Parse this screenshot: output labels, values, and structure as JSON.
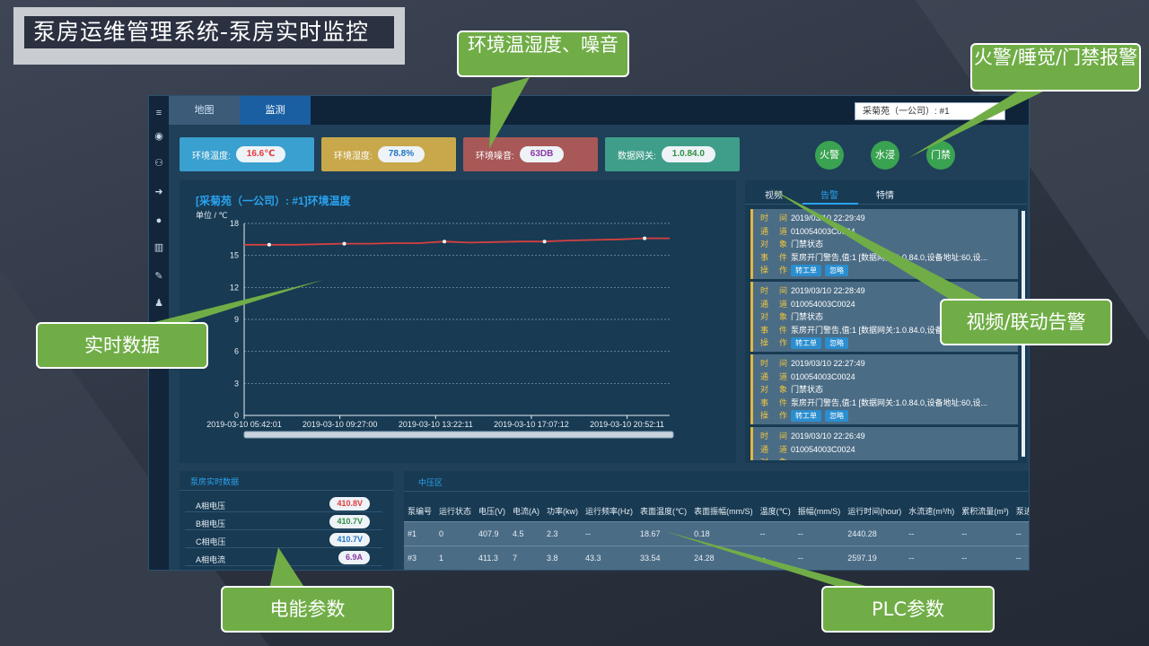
{
  "slide_title": "泵房运维管理系统-泵房实时监控",
  "app": {
    "tabs": [
      {
        "label": "地图"
      },
      {
        "label": "监测"
      }
    ],
    "site_select": "采菊苑（一公司）: #1",
    "env_cards": [
      {
        "label": "环境温度:",
        "value": "16.6℃",
        "color": "#e23b3b"
      },
      {
        "label": "环境湿度:",
        "value": "78.8%",
        "color": "#1f74c2"
      },
      {
        "label": "环境噪音:",
        "value": "63DB",
        "color": "#8b3aa3"
      },
      {
        "label": "数据网关:",
        "value": "1.0.84.0",
        "color": "#2f8e43"
      }
    ],
    "alarm_buttons": [
      {
        "label": "火警"
      },
      {
        "label": "水浸"
      },
      {
        "label": "门禁"
      }
    ],
    "chart_panel": {
      "title": "[采菊苑（一公司）: #1]环境温度",
      "unit": "单位 / ℃"
    },
    "alarm_tabs": [
      {
        "label": "视频"
      },
      {
        "label": "告警"
      },
      {
        "label": "特情"
      }
    ],
    "alarm_keys": {
      "time": "时间",
      "channel": "通道",
      "object": "对象",
      "event": "事件",
      "action": "操作"
    },
    "alarm_buttons_labels": {
      "ticket": "转工单",
      "ignore": "忽略"
    },
    "alarms": [
      {
        "time": "2019/03/10 22:29:49",
        "channel": "010054003C0024",
        "object": "门禁状态",
        "event": "泵房开门警告,值:1 [数据网关:1.0.84.0,设备地址:60,设..."
      },
      {
        "time": "2019/03/10 22:28:49",
        "channel": "010054003C0024",
        "object": "门禁状态",
        "event": "泵房开门警告,值:1 [数据网关:1.0.84.0,设备地址:60,设..."
      },
      {
        "time": "2019/03/10 22:27:49",
        "channel": "010054003C0024",
        "object": "门禁状态",
        "event": "泵房开门警告,值:1 [数据网关:1.0.84.0,设备地址:60,设..."
      },
      {
        "time": "2019/03/10 22:26:49",
        "channel": "010054003C0024",
        "object": "",
        "event": ""
      }
    ],
    "elec_panel": {
      "title": "泵房实时数据",
      "rows": [
        {
          "name": "A相电压",
          "value": "410.8V",
          "color": "#e23b3b"
        },
        {
          "name": "B相电压",
          "value": "410.7V",
          "color": "#2f8e43"
        },
        {
          "name": "C相电压",
          "value": "410.7V",
          "color": "#1f74c2"
        },
        {
          "name": "A相电流",
          "value": "6.9A",
          "color": "#8b3aa3"
        }
      ]
    },
    "plc_panel": {
      "tab": "中压区",
      "headers": [
        "泵编号",
        "运行状态",
        "电压(V)",
        "电流(A)",
        "功率(kw)",
        "运行频率(Hz)",
        "表面温度(℃)",
        "表面振幅(mm/S)",
        "温度(℃)",
        "振幅(mm/S)",
        "运行时间(hour)",
        "水流速(m³/h)",
        "累积流量(m³)",
        "泵进"
      ],
      "rows": [
        [
          "#1",
          "0",
          "407.9",
          "4.5",
          "2.3",
          "--",
          "18.67",
          "0.18",
          "--",
          "--",
          "2440.28",
          "--",
          "--",
          "--"
        ],
        [
          "#3",
          "1",
          "411.3",
          "7",
          "3.8",
          "43.3",
          "33.54",
          "24.28",
          "--",
          "--",
          "2597.19",
          "--",
          "--",
          "--"
        ]
      ]
    }
  },
  "chart_data": {
    "type": "line",
    "title": "[采菊苑（一公司）: #1]环境温度",
    "ylabel": "单位 / ℃",
    "ylim": [
      0,
      18
    ],
    "yticks": [
      0,
      3,
      6,
      9,
      12,
      15,
      18
    ],
    "xticks": [
      "2019-03-10 05:42:01",
      "2019-03-10 09:27:00",
      "2019-03-10 13:22:11",
      "2019-03-10 17:07:12",
      "2019-03-10 20:52:11"
    ],
    "grid": true,
    "series": [
      {
        "values": [
          16.0,
          16.0,
          16.0,
          16.05,
          16.1,
          16.1,
          16.15,
          16.15,
          16.3,
          16.2,
          16.25,
          16.3,
          16.3,
          16.4,
          16.45,
          16.5,
          16.6,
          16.6
        ]
      }
    ],
    "markers": [
      1,
      4,
      8,
      12,
      16
    ],
    "line_color": "#d64040"
  },
  "callouts": [
    {
      "text": "环境温湿度、噪音"
    },
    {
      "text": "火警/睡觉/门禁报警"
    },
    {
      "text": "实时数据"
    },
    {
      "text": "视频/联动告警"
    },
    {
      "text": "电能参数"
    },
    {
      "text": "PLC参数"
    }
  ]
}
